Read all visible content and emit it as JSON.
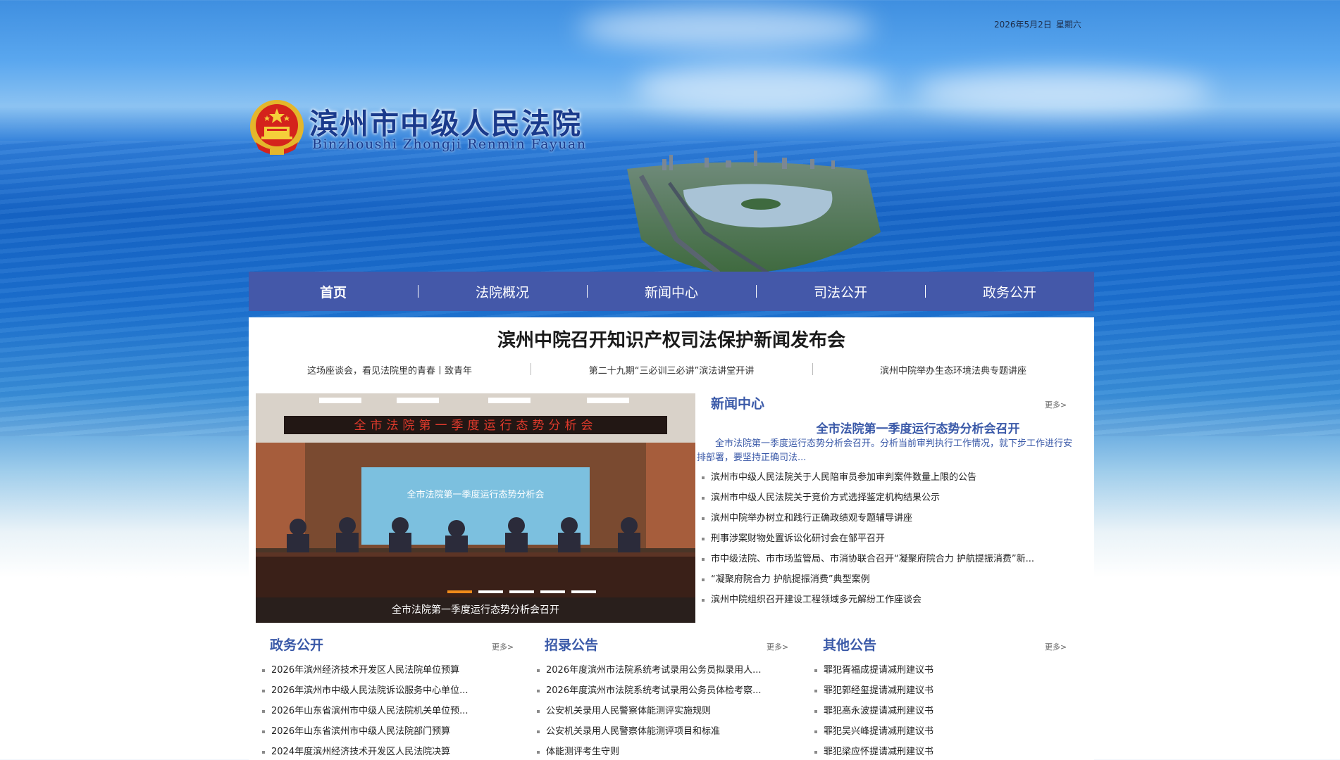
{
  "top": {
    "date": "2026年5月2日",
    "weekday": "星期六"
  },
  "header": {
    "title": "滨州市中级人民法院",
    "pinyin": "Binzhoushi Zhongji Renmin Fayuan"
  },
  "nav": {
    "items": [
      "首页",
      "法院概况",
      "新闻中心",
      "司法公开",
      "政务公开"
    ]
  },
  "headline": "滨州中院召开知识产权司法保护新闻发布会",
  "sub_headlines": [
    "这场座谈会，看见法院里的青春丨致青年",
    "第二十九期“三必训三必讲”滨法讲堂开讲",
    "滨州中院举办生态环境法典专题讲座"
  ],
  "slider": {
    "caption": "全市法院第一季度运行态势分析会召开",
    "banner_text": "全市法院第一季度运行态势分析会",
    "screen_text": "全市法院第一季度运行态势分析会"
  },
  "news_center": {
    "title": "新闻中心",
    "more": "更多>",
    "feature_title": "全市法院第一季度运行态势分析会召开",
    "feature_summary": "全市法院第一季度运行态势分析会召开。分析当前审判执行工作情况，就下步工作进行安排部署，要坚持正确司法...",
    "items": [
      "滨州市中级人民法院关于人民陪审员参加审判案件数量上限的公告",
      "滨州市中级人民法院关于竞价方式选择鉴定机构结果公示",
      "滨州中院举办树立和践行正确政绩观专题辅导讲座",
      "刑事涉案财物处置诉讼化研讨会在邹平召开",
      "市中级法院、市市场监管局、市消协联合召开“凝聚府院合力 护航提振消费”新...",
      "“凝聚府院合力 护航提振消费”典型案例",
      "滨州中院组织召开建设工程领域多元解纷工作座谈会"
    ]
  },
  "gov_affairs": {
    "title": "政务公开",
    "more": "更多>",
    "items": [
      "2026年滨州经济技术开发区人民法院单位预算",
      "2026年滨州市中级人民法院诉讼服务中心单位...",
      "2026年山东省滨州市中级人民法院机关单位预...",
      "2026年山东省滨州市中级人民法院部门预算",
      "2024年度滨州经济技术开发区人民法院决算"
    ]
  },
  "recruit": {
    "title": "招录公告",
    "more": "更多>",
    "items": [
      "2026年度滨州市法院系统考试录用公务员拟录用人...",
      "2026年度滨州市法院系统考试录用公务员体检考察...",
      "公安机关录用人民警察体能测评实施规则",
      "公安机关录用人民警察体能测评项目和标准",
      "体能测评考生守则"
    ]
  },
  "other": {
    "title": "其他公告",
    "more": "更多>",
    "items": [
      "罪犯胥福成提请减刑建议书",
      "罪犯郭经玺提请减刑建议书",
      "罪犯高永波提请减刑建议书",
      "罪犯吴兴峰提请减刑建议书",
      "罪犯梁应怀提请减刑建议书"
    ]
  },
  "colors": {
    "nav_bg": "#4458a9",
    "accent": "#3a59a8",
    "dot_active": "#f08b1a"
  }
}
